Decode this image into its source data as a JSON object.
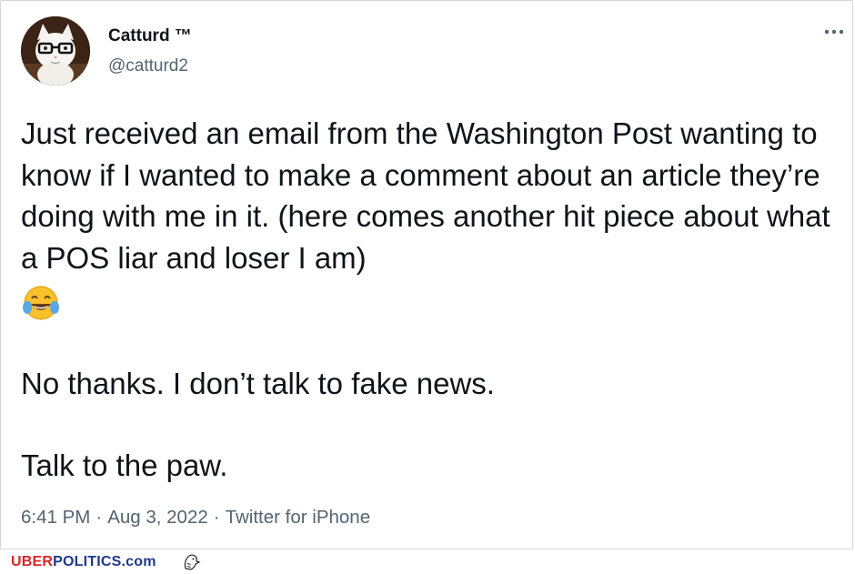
{
  "tweet": {
    "author": {
      "display_name": "Catturd ™",
      "handle": "@catturd2",
      "avatar_icon": "cat-with-glasses-avatar"
    },
    "more_icon": "more-options-icon",
    "paragraphs": [
      "Just received an email from the Washington Post wanting to know if I wanted to make a comment about an article they’re doing with me in it. (here comes another hit piece about what a POS liar and loser I am)",
      "No thanks. I don’t talk to fake news.",
      "Talk to the paw."
    ],
    "emoji": "face-with-tears-of-joy",
    "meta": {
      "time": "6:41 PM",
      "separator": "·",
      "date": "Aug 3, 2022",
      "source": "Twitter for iPhone"
    }
  },
  "watermark": {
    "uber": "UBER",
    "politics": "POLITICS.com",
    "icon": "eagle-icon",
    "colors": {
      "uber": "#d6262c",
      "politics": "#1f3a8a"
    }
  }
}
